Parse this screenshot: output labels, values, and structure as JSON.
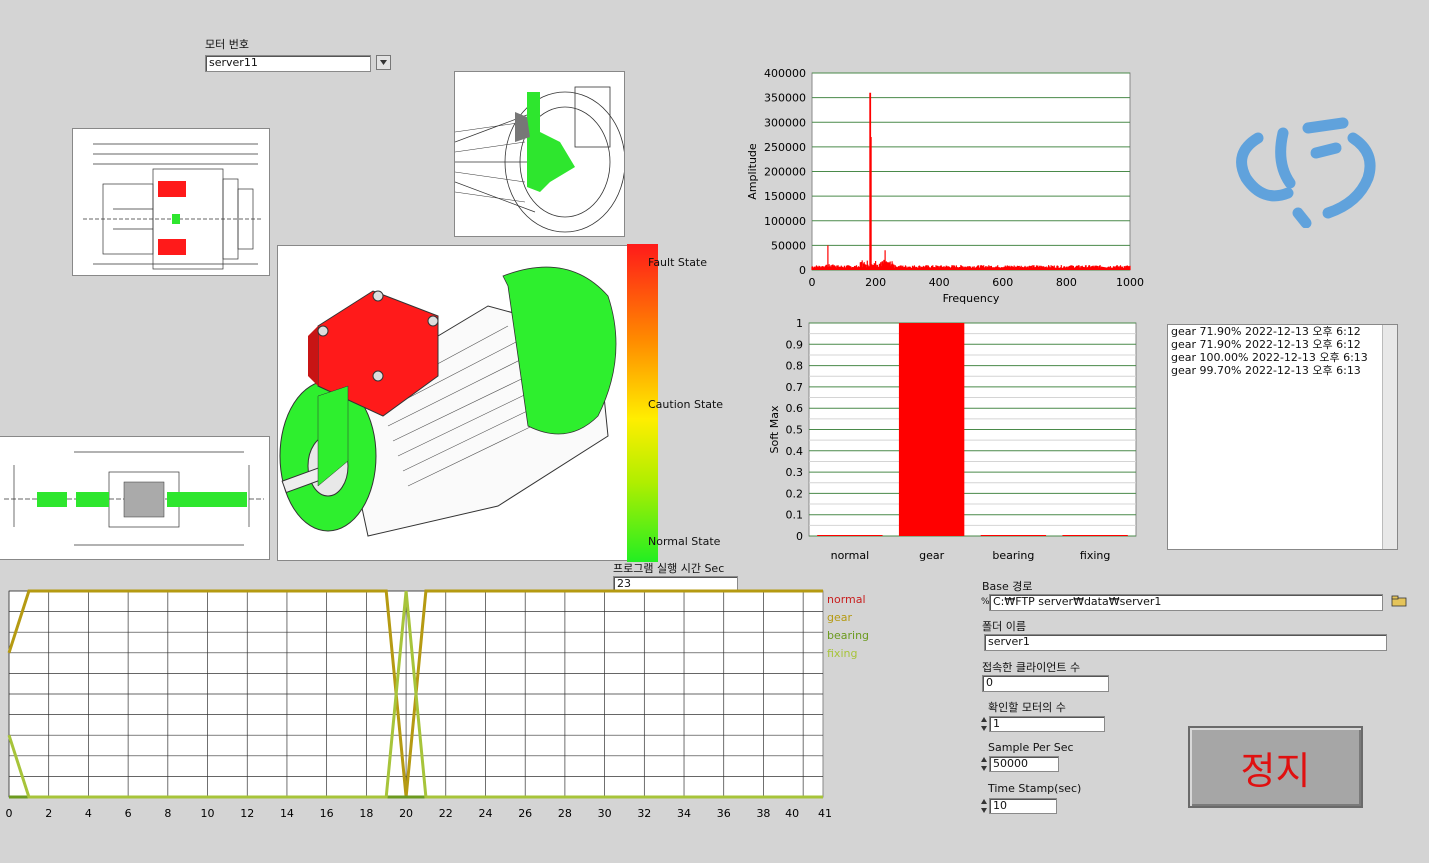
{
  "motor_select": {
    "label": "모터 번호",
    "value": "server11"
  },
  "state_scale": {
    "fault": "Fault State",
    "caution": "Caution State",
    "normal": "Normal State"
  },
  "runtime": {
    "label": "프로그램 실행 시간 Sec",
    "value": "23"
  },
  "fft_chart": {
    "type": "line",
    "xlabel": "Frequency",
    "ylabel": "Amplitude",
    "xlim": [
      0,
      1000
    ],
    "ylim": [
      0,
      400000
    ],
    "x_ticks": [
      "0",
      "200",
      "400",
      "600",
      "800",
      "1000"
    ],
    "y_ticks": [
      "0",
      "50000",
      "100000",
      "150000",
      "200000",
      "250000",
      "300000",
      "350000",
      "400000"
    ],
    "line_color": "#ff0000",
    "peaks": [
      [
        50,
        50000
      ],
      [
        183,
        360000
      ],
      [
        186,
        270000
      ],
      [
        230,
        40000
      ]
    ]
  },
  "chart_data": [
    {
      "type": "bar",
      "categories": [
        "normal",
        "gear",
        "bearing",
        "fixing"
      ],
      "values": [
        0.0,
        1.0,
        0.0,
        0.0
      ],
      "ylabel": "Soft Max",
      "ylim": [
        0,
        1
      ],
      "y_ticks": [
        "0",
        "0.1",
        "0.2",
        "0.3",
        "0.4",
        "0.5",
        "0.6",
        "0.7",
        "0.8",
        "0.9",
        "1"
      ],
      "bar_color": "#ff0000"
    },
    {
      "type": "line",
      "xlim": [
        0,
        41
      ],
      "x_ticks": [
        "0",
        "2",
        "4",
        "6",
        "8",
        "10",
        "12",
        "14",
        "16",
        "18",
        "20",
        "22",
        "24",
        "26",
        "28",
        "30",
        "32",
        "34",
        "36",
        "38",
        "40",
        "41"
      ],
      "series": [
        {
          "name": "normal",
          "color": "#c81e1e",
          "x": [
            0,
            41
          ],
          "y": [
            0,
            0
          ]
        },
        {
          "name": "gear",
          "color": "#b59a12",
          "x": [
            0,
            1,
            19,
            20,
            21,
            41
          ],
          "y": [
            0.7,
            1,
            1,
            0,
            1,
            1
          ]
        },
        {
          "name": "bearing",
          "color": "#6b9a1e",
          "x": [
            0,
            41
          ],
          "y": [
            0,
            0
          ]
        },
        {
          "name": "fixing",
          "color": "#a7c43a",
          "x": [
            0,
            1,
            19,
            20,
            21,
            41
          ],
          "y": [
            0.3,
            0,
            0,
            1,
            0,
            0
          ]
        }
      ]
    }
  ],
  "results_list": [
    "gear 71.90% 2022-12-13 오후 6:12",
    "gear 71.90% 2022-12-13 오후 6:12",
    "gear 100.00% 2022-12-13 오후 6:13",
    "gear 99.70% 2022-12-13 오후 6:13"
  ],
  "base_path": {
    "label": "Base 경로",
    "value": "C:₩FTP server₩data₩server1"
  },
  "folder_name": {
    "label": "폴더 이름",
    "value": "server1"
  },
  "clients": {
    "label": "접속한 클라이언트 수",
    "value": "0"
  },
  "motor_count": {
    "label": "확인할 모터의 수",
    "value": "1"
  },
  "sample_rate": {
    "label": "Sample Per Sec",
    "value": "50000"
  },
  "time_stamp": {
    "label": "Time Stamp(sec)",
    "value": "10"
  },
  "stop_button": {
    "label": "정지"
  }
}
